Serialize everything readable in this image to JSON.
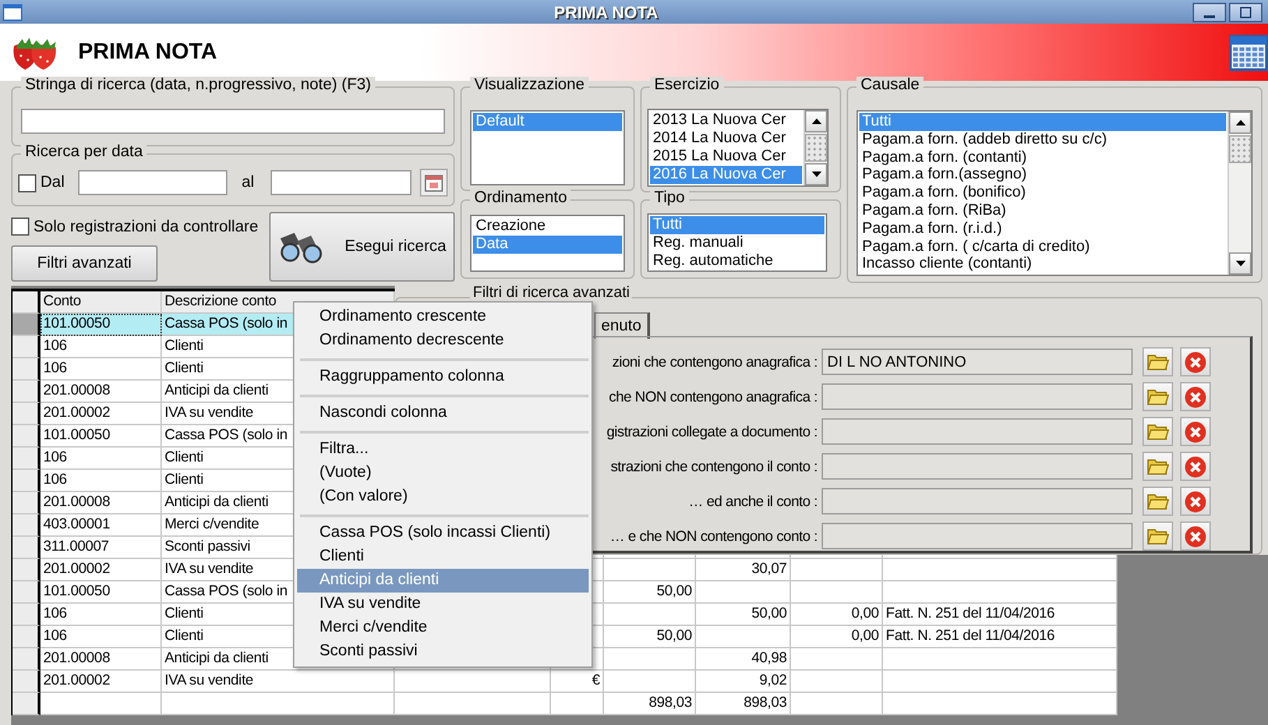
{
  "window": {
    "title": "PRIMA NOTA"
  },
  "header": {
    "title": "PRIMA NOTA"
  },
  "search": {
    "label": "Stringa di ricerca (data, n.progressivo, note) (F3)"
  },
  "date_search": {
    "label": "Ricerca per data",
    "from": {
      "label": "Dal",
      "checked": false
    },
    "to_label": "al"
  },
  "only_to_check": {
    "label": "Solo registrazioni da controllare",
    "checked": false
  },
  "buttons": {
    "advanced": "Filtri avanzati",
    "run": "Esegui ricerca"
  },
  "visualizzazione": {
    "label": "Visualizzazione",
    "items": [
      {
        "label": "Default",
        "selected": true
      }
    ]
  },
  "ordinamento": {
    "label": "Ordinamento",
    "items": [
      {
        "label": "Creazione",
        "selected": false
      },
      {
        "label": "Data",
        "selected": true
      }
    ]
  },
  "esercizio": {
    "label": "Esercizio",
    "items": [
      {
        "label": "2013 La Nuova Cer",
        "selected": false
      },
      {
        "label": "2014 La Nuova Cer",
        "selected": false
      },
      {
        "label": "2015 La Nuova Cer",
        "selected": false
      },
      {
        "label": "2016 La Nuova Cer",
        "selected": true
      }
    ]
  },
  "tipo": {
    "label": "Tipo",
    "items": [
      {
        "label": "Tutti",
        "selected": true
      },
      {
        "label": "Reg. manuali",
        "selected": false
      },
      {
        "label": "Reg. automatiche",
        "selected": false
      }
    ]
  },
  "causale": {
    "label": "Causale",
    "items": [
      {
        "label": "Tutti",
        "selected": true
      },
      {
        "label": "Pagam.a forn. (addeb diretto su c/c)",
        "selected": false
      },
      {
        "label": "Pagam.a forn. (contanti)",
        "selected": false
      },
      {
        "label": "Pagam.a forn.(assegno)",
        "selected": false
      },
      {
        "label": "Pagam.a forn. (bonifico)",
        "selected": false
      },
      {
        "label": "Pagam.a forn. (RiBa)",
        "selected": false
      },
      {
        "label": "Pagam.a forn. (r.i.d.)",
        "selected": false
      },
      {
        "label": "Pagam.a forn. ( c/carta di credito)",
        "selected": false
      },
      {
        "label": "Incasso cliente (contanti)",
        "selected": false
      }
    ]
  },
  "table": {
    "columns": [
      "Conto",
      "Descrizione conto"
    ],
    "rows": [
      {
        "conto": "101.00050",
        "descrizione": "Cassa POS (solo in",
        "selected": true
      },
      {
        "conto": "106",
        "descrizione": "Clienti",
        "selected": false
      },
      {
        "conto": "106",
        "descrizione": "Clienti",
        "selected": false
      },
      {
        "conto": "201.00008",
        "descrizione": "Anticipi da clienti",
        "selected": false
      },
      {
        "conto": "201.00002",
        "descrizione": "IVA su vendite",
        "selected": false
      },
      {
        "conto": "101.00050",
        "descrizione": "Cassa POS (solo in",
        "selected": false
      },
      {
        "conto": "106",
        "descrizione": "Clienti",
        "selected": false
      },
      {
        "conto": "106",
        "descrizione": "Clienti",
        "selected": false
      },
      {
        "conto": "201.00008",
        "descrizione": "Anticipi da clienti",
        "selected": false
      },
      {
        "conto": "403.00001",
        "descrizione": "Merci c/vendite",
        "selected": false
      },
      {
        "conto": "311.00007",
        "descrizione": "Sconti passivi",
        "selected": false
      },
      {
        "conto": "201.00002",
        "descrizione": "IVA su vendite",
        "column_6": "30,07",
        "selected": false
      },
      {
        "conto": "101.00050",
        "descrizione": "Cassa POS (solo in",
        "column_5": "50,00",
        "selected": false
      },
      {
        "conto": "106",
        "descrizione": "Clienti",
        "column_6": "50,00",
        "column_7": "0,00",
        "column_8": "Fatt. N. 251 del 11/04/2016",
        "selected": false
      },
      {
        "conto": "106",
        "descrizione": "Clienti",
        "column_5": "50,00",
        "column_7": "0,00",
        "column_8": "Fatt. N. 251 del 11/04/2016",
        "selected": false
      },
      {
        "conto": "201.00008",
        "descrizione": "Anticipi da clienti",
        "column_6": "40,98",
        "selected": false
      },
      {
        "conto": "201.00002",
        "descrizione": "IVA su vendite",
        "column_4": "€",
        "column_6": "9,02",
        "selected": false
      }
    ],
    "totals": {
      "column_5": "898,03",
      "column_6": "898,03"
    }
  },
  "advanced_filters": {
    "title": "Filtri di ricerca avanzati",
    "tab": {
      "label": "enuto",
      "selected": true
    },
    "rows": [
      {
        "label": "zioni che contengono anagrafica :",
        "value": "DI L NO ANTONINO"
      },
      {
        "label": "che NON contengono anagrafica :"
      },
      {
        "label": "gistrazioni collegate a documento :"
      },
      {
        "label": "strazioni che contengono il conto :"
      },
      {
        "label": "… ed anche il conto :"
      },
      {
        "label": "… e che NON contengono conto :"
      }
    ]
  },
  "context_menu": {
    "items": [
      {
        "kind": "item",
        "label": "Ordinamento crescente",
        "selected": false
      },
      {
        "kind": "item",
        "label": "Ordinamento decrescente",
        "selected": false
      },
      {
        "kind": "separator"
      },
      {
        "kind": "item",
        "label": "Raggruppamento colonna",
        "selected": false
      },
      {
        "kind": "separator"
      },
      {
        "kind": "item",
        "label": "Nascondi colonna",
        "selected": false
      },
      {
        "kind": "separator"
      },
      {
        "kind": "item",
        "label": "Filtra...",
        "selected": false
      },
      {
        "kind": "item",
        "label": "(Vuote)",
        "selected": false
      },
      {
        "kind": "item",
        "label": "(Con valore)",
        "selected": false
      },
      {
        "kind": "separator"
      },
      {
        "kind": "item",
        "label": "Cassa POS (solo incassi Clienti)",
        "selected": false
      },
      {
        "kind": "item",
        "label": "Clienti",
        "selected": false
      },
      {
        "kind": "item",
        "label": "Anticipi da clienti",
        "selected": true
      },
      {
        "kind": "item",
        "label": "IVA su vendite",
        "selected": false
      },
      {
        "kind": "item",
        "label": "Merci c/vendite",
        "selected": false
      },
      {
        "kind": "item",
        "label": "Sconti passivi",
        "selected": false
      }
    ]
  }
}
